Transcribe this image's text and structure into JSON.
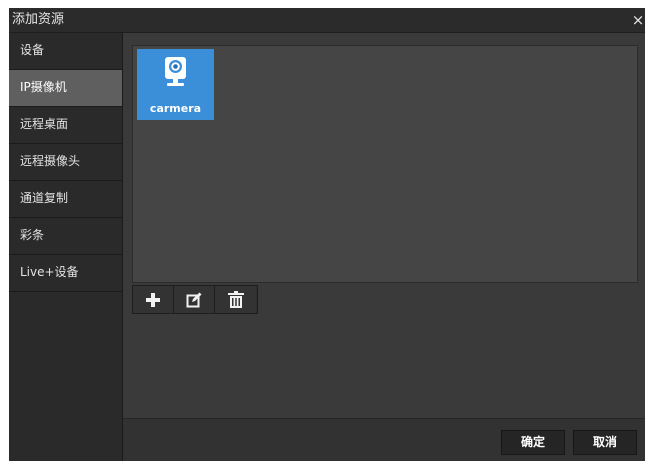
{
  "dialog": {
    "title": "添加资源",
    "close_glyph": "×"
  },
  "sidebar": {
    "items": [
      {
        "label": "设备",
        "active": false
      },
      {
        "label": "IP摄像机",
        "active": true
      },
      {
        "label": "远程桌面",
        "active": false
      },
      {
        "label": "远程摄像头",
        "active": false
      },
      {
        "label": "通道复制",
        "active": false
      },
      {
        "label": "彩条",
        "active": false
      },
      {
        "label": "Live+设备",
        "active": false
      }
    ]
  },
  "resources": [
    {
      "label": "carmera",
      "icon": "camera-icon",
      "selected": true
    }
  ],
  "toolbar": {
    "buttons": [
      {
        "icon": "add-icon"
      },
      {
        "icon": "edit-icon"
      },
      {
        "icon": "delete-icon"
      }
    ]
  },
  "footer": {
    "ok_label": "确定",
    "cancel_label": "取消"
  },
  "colors": {
    "accent": "#3b8fd8",
    "panel": "#3a3a3a",
    "sidebar_active": "#5f5f5f"
  }
}
